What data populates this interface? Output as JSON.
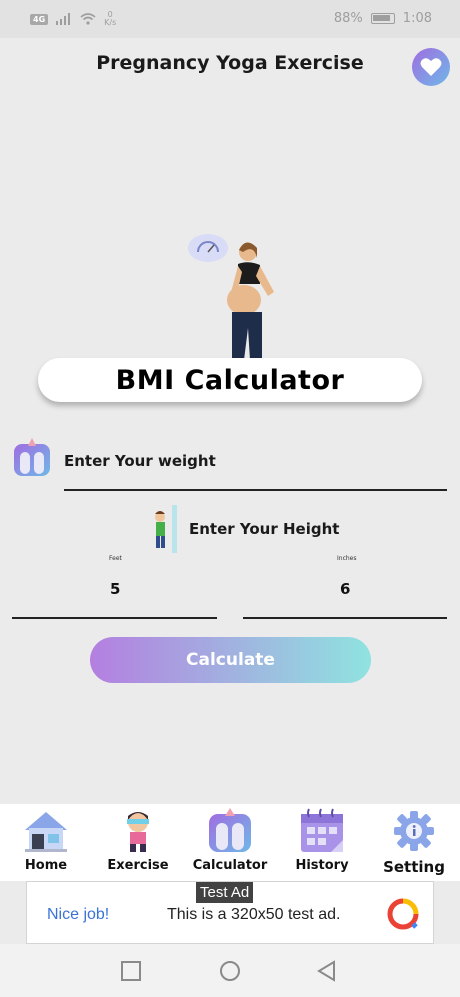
{
  "status_bar": {
    "network": "4G",
    "speed_value": "0",
    "speed_unit": "K/s",
    "battery": "88%",
    "time": "1:08"
  },
  "header": {
    "title": "Pregnancy Yoga Exercise"
  },
  "hero": {
    "title": "BMI Calculator"
  },
  "form": {
    "weight_label": "Enter Your weight",
    "height_label": "Enter Your Height",
    "feet_label": "Feet",
    "feet_value": "5",
    "inches_label": "Inches",
    "inches_value": "6",
    "calculate_label": "Calculate"
  },
  "bottom_nav": {
    "items": [
      {
        "label": "Home",
        "icon": "home-icon"
      },
      {
        "label": "Exercise",
        "icon": "exercise-icon"
      },
      {
        "label": "Calculator",
        "icon": "scale-icon"
      },
      {
        "label": "History",
        "icon": "calendar-icon"
      },
      {
        "label": "Setting",
        "icon": "gear-icon"
      }
    ]
  },
  "ad": {
    "tag": "Test Ad",
    "nice_job": "Nice job!",
    "text": "This is a 320x50 test ad."
  },
  "colors": {
    "accent_start": "#b47fe0",
    "accent_end": "#8fe3e0",
    "background": "#ebebeb"
  }
}
